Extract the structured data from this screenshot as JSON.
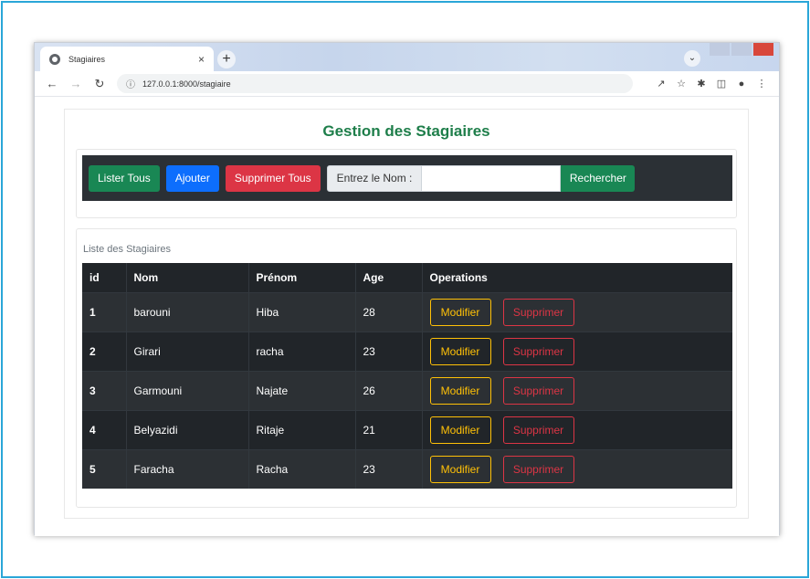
{
  "browser": {
    "tab_title": "Stagiaires",
    "tab_close": "×",
    "new_tab": "+",
    "url": "127.0.0.1:8000/stagiaire"
  },
  "page": {
    "title": "Gestion des Stagiaires"
  },
  "actions": {
    "list_all": "Lister Tous",
    "add": "Ajouter",
    "delete_all": "Supprimer Tous",
    "search_label": "Entrez le Nom :",
    "search_value": "",
    "search_button": "Rechercher"
  },
  "list": {
    "header": "Liste des Stagiaires",
    "columns": [
      "id",
      "Nom",
      "Prénom",
      "Age",
      "Operations"
    ],
    "rows": [
      {
        "id": "1",
        "nom": "barouni",
        "prenom": "Hiba",
        "age": "28"
      },
      {
        "id": "2",
        "nom": "Girari",
        "prenom": "racha",
        "age": "23"
      },
      {
        "id": "3",
        "nom": "Garmouni",
        "prenom": "Najate",
        "age": "26"
      },
      {
        "id": "4",
        "nom": "Belyazidi",
        "prenom": "Ritaje",
        "age": "21"
      },
      {
        "id": "5",
        "nom": "Faracha",
        "prenom": "Racha",
        "age": "23"
      }
    ],
    "edit_label": "Modifier",
    "delete_label": "Supprimer"
  },
  "colors": {
    "title_green": "#1e7e4a",
    "success": "#198754",
    "primary": "#0d6efd",
    "danger": "#dc3545",
    "warning": "#ffc107",
    "table_dark": "#212529"
  }
}
